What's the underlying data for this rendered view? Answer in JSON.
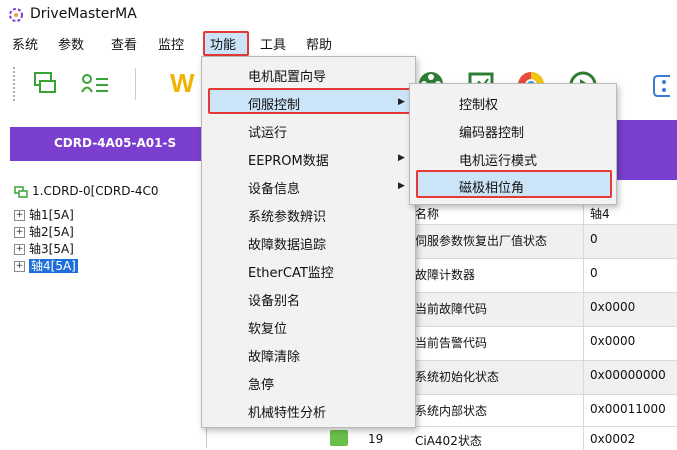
{
  "app": {
    "title": "DriveMasterMA"
  },
  "menubar": {
    "items": [
      "系统",
      "参数",
      "查看",
      "监控",
      "功能",
      "工具",
      "帮助"
    ]
  },
  "toolbar": {
    "w_label": "W"
  },
  "device": {
    "label": "CDRD-4A05-A01-S"
  },
  "tree": {
    "root": "1.CDRD-0[CDRD-4C0",
    "axes": [
      "轴1[5A]",
      "轴2[5A]",
      "轴3[5A]",
      "轴4[5A]"
    ]
  },
  "func_menu": {
    "items": [
      "电机配置向导",
      "伺服控制",
      "试运行",
      "EEPROM数据",
      "设备信息",
      "系统参数辨识",
      "故障数据追踪",
      "EtherCAT监控",
      "设备别名",
      "软复位",
      "故障清除",
      "急停",
      "机械特性分析"
    ]
  },
  "servo_submenu": {
    "items": [
      "控制权",
      "编码器控制",
      "电机运行模式",
      "磁极相位角"
    ]
  },
  "table": {
    "header": {
      "name": "名称",
      "value": "轴4"
    },
    "rows": [
      {
        "name": "伺服参数恢复出厂值状态",
        "value": "0"
      },
      {
        "name": "故障计数器",
        "value": "0"
      },
      {
        "name": "当前故障代码",
        "value": "0x0000"
      },
      {
        "name": "当前告警代码",
        "value": "0x0000"
      },
      {
        "name": "系统初始化状态",
        "value": "0x00000000"
      },
      {
        "name": "系统内部状态",
        "value": "0x00011000"
      },
      {
        "index": "19",
        "name": "CiA402状态",
        "value": "0x0002"
      }
    ]
  },
  "colors": {
    "accent": "#7b3fd0",
    "highlight_border": "#e53935",
    "selection": "#1e6fd9"
  }
}
